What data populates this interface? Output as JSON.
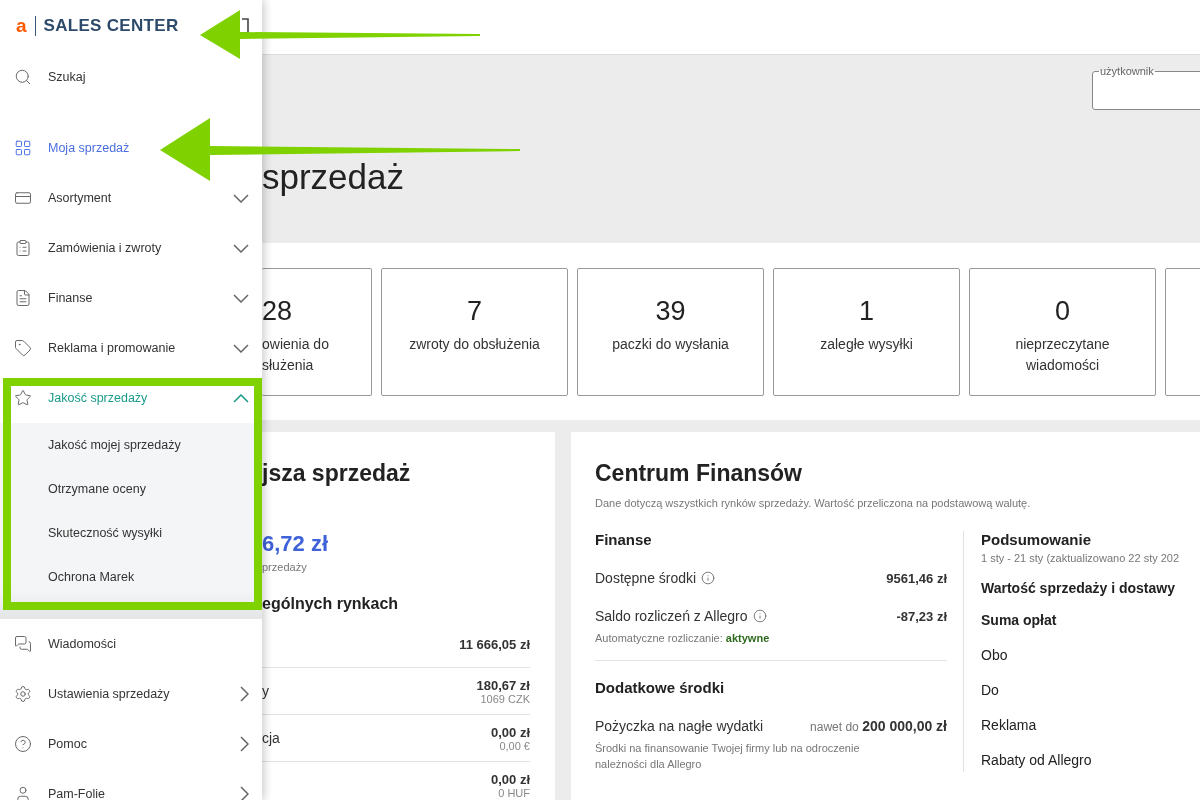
{
  "sidebar": {
    "logo": {
      "mark": "a",
      "title": "SALES CENTER"
    },
    "items": [
      {
        "label": "Szukaj",
        "kind": "plain",
        "selected": false
      },
      {
        "label": "Moja sprzedaż",
        "kind": "plain",
        "selected": true
      },
      {
        "label": "Asortyment",
        "kind": "group",
        "selected": false,
        "expanded": false
      },
      {
        "label": "Zamówienia i zwroty",
        "kind": "group",
        "selected": false,
        "expanded": false
      },
      {
        "label": "Finanse",
        "kind": "group",
        "selected": false,
        "expanded": false
      },
      {
        "label": "Reklama i promowanie",
        "kind": "group",
        "selected": false,
        "expanded": false
      },
      {
        "label": "Jakość sprzedaży",
        "kind": "group",
        "selected": false,
        "expanded": true,
        "children": [
          {
            "label": "Jakość mojej sprzedaży"
          },
          {
            "label": "Otrzymane oceny"
          },
          {
            "label": "Skuteczność wysyłki"
          },
          {
            "label": "Ochrona Marek"
          }
        ]
      },
      {
        "label": "Wiadomości",
        "kind": "plain",
        "selected": false
      },
      {
        "label": "Ustawienia sprzedaży",
        "kind": "link",
        "selected": false
      },
      {
        "label": "Pomoc",
        "kind": "link",
        "selected": false
      },
      {
        "label": "Pam-Folie",
        "kind": "link",
        "selected": false
      }
    ]
  },
  "header": {
    "user_field": {
      "label": "użytkownik"
    },
    "title": "sprzedaż"
  },
  "stats": [
    {
      "value": "28",
      "label": "owienia do służenia"
    },
    {
      "value": "7",
      "label": "zwroty do obsłużenia"
    },
    {
      "value": "39",
      "label": "paczki do wysłania"
    },
    {
      "value": "1",
      "label": "zaległe wysyłki"
    },
    {
      "value": "0",
      "label": "nieprzeczytane wiadomości"
    }
  ],
  "sales_panel": {
    "title": "jsza sprzedaż",
    "amount": "6,72 zł",
    "amount_caption": "przedaży",
    "markets_title": "ególnych rynkach",
    "markets": [
      {
        "value": "11 666,05 zł"
      },
      {
        "label": "y",
        "value": "180,67 zł",
        "sub": "1069 CZK"
      },
      {
        "label": "cja",
        "value": "0,00 zł",
        "sub": "0,00 €"
      },
      {
        "value": "0,00 zł",
        "sub": "0 HUF"
      }
    ]
  },
  "finance_panel": {
    "title": "Centrum Finansów",
    "note": "Dane dotyczą wszystkich rynków sprzedaży. Wartość przeliczona na podstawową walutę.",
    "finances": {
      "title": "Finanse",
      "rows": [
        {
          "label": "Dostępne środki",
          "value": "9561,46 zł",
          "info": true
        },
        {
          "label": "Saldo rozliczeń z Allegro",
          "value": "-87,23 zł",
          "info": true,
          "note": "Automatyczne rozliczanie: **aktywne**"
        }
      ]
    },
    "extra": {
      "title": "Dodatkowe środki",
      "rows": [
        {
          "label": "Pożyczka na nagłe wydatki",
          "value": "nawet do **200 000,00 zł**",
          "info": false,
          "note": "Środki na finansowanie Twojej firmy lub na odroczenie należności dla Allegro"
        }
      ]
    },
    "summary": {
      "title": "Podsumowanie",
      "period": "1 sty - 21 sty (zaktualizowano 22 sty 202",
      "rows": [
        {
          "label": "Wartość sprzedaży i dostawy",
          "kind": "bold"
        },
        {
          "label": "Suma opłat",
          "kind": "bold"
        },
        {
          "label": "Obo",
          "kind": "plain"
        },
        {
          "label": "Do",
          "kind": "plain"
        },
        {
          "label": "Reklama",
          "kind": "plain"
        },
        {
          "label": "Rabaty od Allegro",
          "kind": "plain"
        }
      ]
    }
  }
}
